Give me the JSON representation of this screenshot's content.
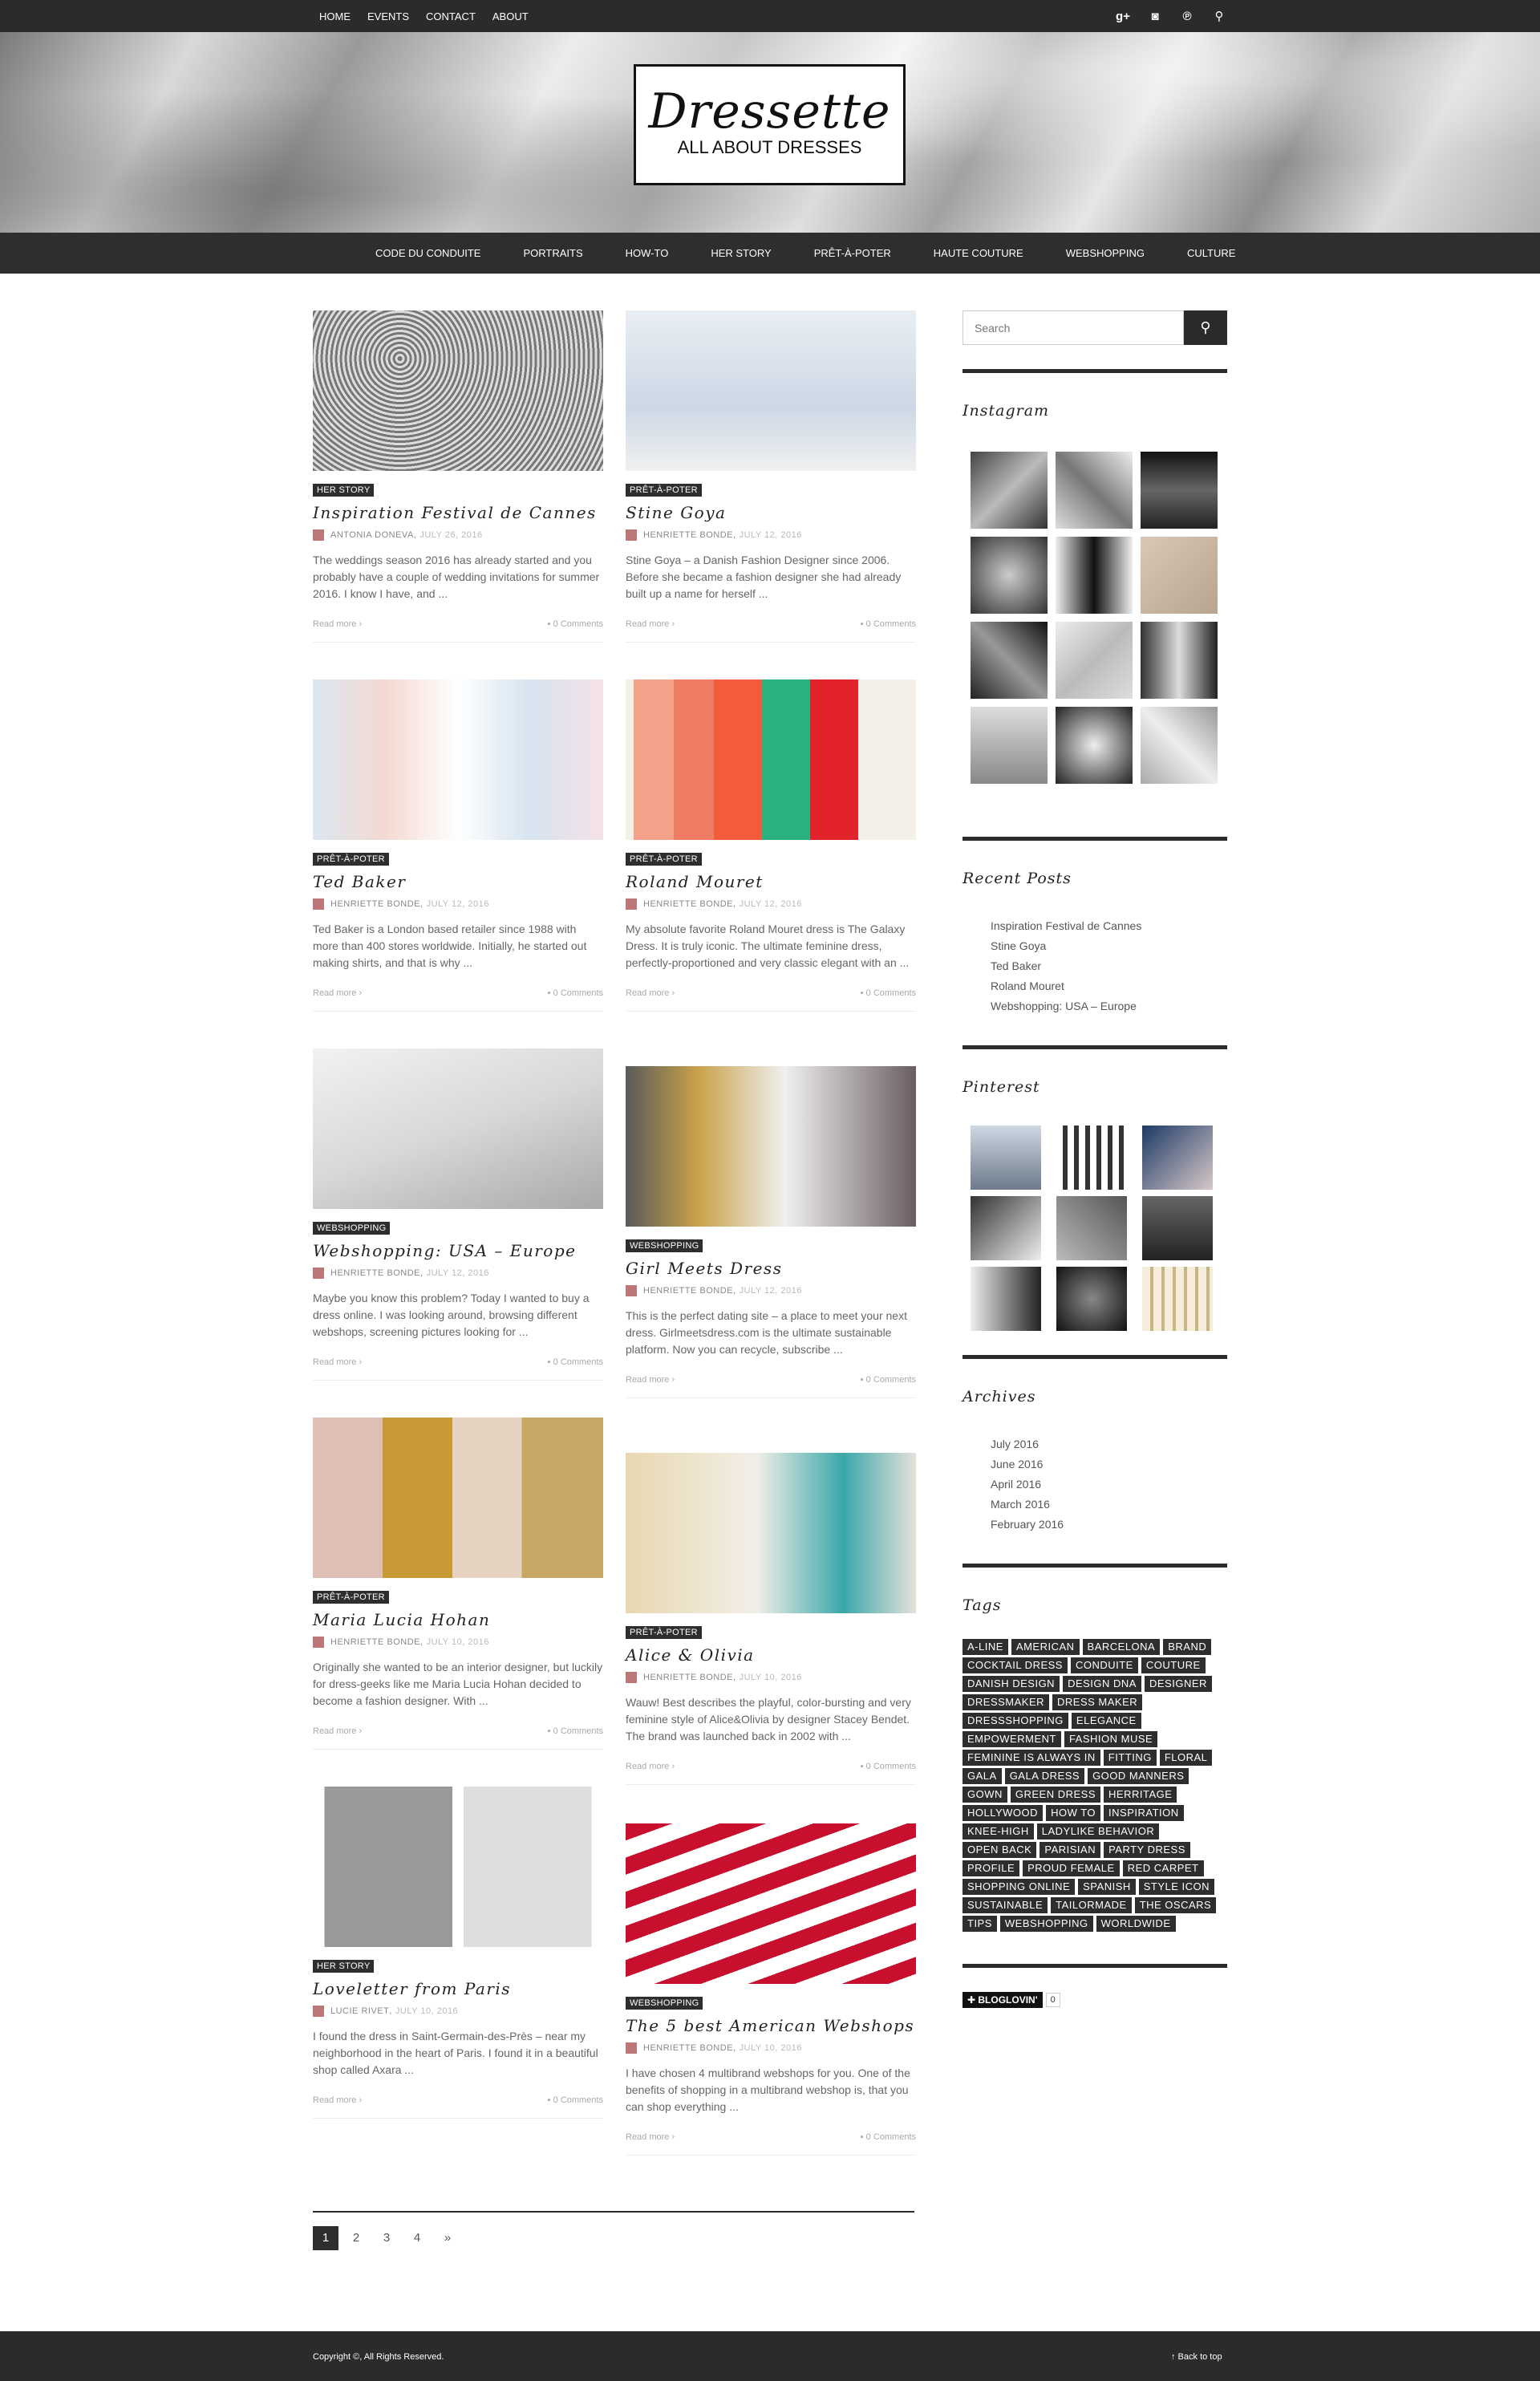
{
  "topbar": {
    "nav": [
      "HOME",
      "EVENTS",
      "CONTACT",
      "ABOUT"
    ],
    "icons": [
      "google-plus-icon",
      "instagram-icon",
      "pinterest-icon",
      "search-icon"
    ]
  },
  "header": {
    "logo_title": "Dressette",
    "logo_subtitle": "ALL ABOUT DRESSES"
  },
  "catnav": [
    "CODE DU CONDUITE",
    "PORTRAITS",
    "HOW-TO",
    "HER STORY",
    "PRÊT-À-POTER",
    "HAUTE COUTURE",
    "WEBSHOPPING",
    "CULTURE"
  ],
  "posts": [
    {
      "cat": "HER STORY",
      "title": "Inspiration Festival de Cannes",
      "author": "ANTONIA DONEVA",
      "date": "JULY 26, 2016",
      "excerpt": "The weddings season 2016 has already started and you probably have a couple of wedding invitations for summer 2016. I know I have, and ...",
      "read": "Read more",
      "comments": "0 Comments"
    },
    {
      "cat": "PRÊT-À-POTER",
      "title": "Stine Goya",
      "author": "HENRIETTE BONDE",
      "date": "JULY 12, 2016",
      "excerpt": "Stine Goya – a Danish Fashion Designer since 2006. Before she became a fashion designer she had already built up a name for herself ...",
      "read": "Read more",
      "comments": "0 Comments"
    },
    {
      "cat": "PRÊT-À-POTER",
      "title": "Ted Baker",
      "author": "HENRIETTE BONDE",
      "date": "JULY 12, 2016",
      "excerpt": "Ted Baker is a London based retailer since 1988 with more than 400 stores worldwide. Initially, he started out making shirts, and that is why ...",
      "read": "Read more",
      "comments": "0 Comments"
    },
    {
      "cat": "PRÊT-À-POTER",
      "title": "Roland Mouret",
      "author": "HENRIETTE BONDE",
      "date": "JULY 12, 2016",
      "excerpt": "My absolute favorite Roland Mouret dress is The Galaxy Dress. It is truly iconic. The ultimate feminine dress, perfectly-proportioned and very classic elegant with an ...",
      "read": "Read more",
      "comments": "0 Comments"
    },
    {
      "cat": "WEBSHOPPING",
      "title": "Webshopping: USA – Europe",
      "author": "HENRIETTE BONDE",
      "date": "JULY 12, 2016",
      "excerpt": "Maybe you know this problem? Today I wanted to buy a dress online. I was looking around, browsing different webshops, screening pictures looking for ...",
      "read": "Read more",
      "comments": "0 Comments"
    },
    {
      "cat": "WEBSHOPPING",
      "title": "Girl Meets Dress",
      "author": "HENRIETTE BONDE",
      "date": "JULY 12, 2016",
      "excerpt": "This is the perfect dating site – a place to meet your next dress. Girlmeetsdress.com is the ultimate sustainable platform. Now you can recycle, subscribe ...",
      "read": "Read more",
      "comments": "0 Comments"
    },
    {
      "cat": "PRÊT-À-POTER",
      "title": "Maria Lucia Hohan",
      "author": "HENRIETTE BONDE",
      "date": "JULY 10, 2016",
      "excerpt": "Originally she wanted to be an interior designer, but luckily for dress-geeks like me Maria Lucia Hohan decided to become a fashion designer. With ...",
      "read": "Read more",
      "comments": "0 Comments"
    },
    {
      "cat": "PRÊT-À-POTER",
      "title": "Alice & Olivia",
      "author": "HENRIETTE BONDE",
      "date": "JULY 10, 2016",
      "excerpt": "Wauw! Best describes the playful, color-bursting and very feminine style of Alice&Olivia by designer Stacey Bendet. The brand was launched back in 2002 with ...",
      "read": "Read more",
      "comments": "0 Comments"
    },
    {
      "cat": "HER STORY",
      "title": "Loveletter from Paris",
      "author": "LUCIE RIVET",
      "date": "JULY 10, 2016",
      "excerpt": "I found the dress in Saint-Germain-des-Près – near my neighborhood in the heart of Paris. I found it in a beautiful shop called Axara ...",
      "read": "Read more",
      "comments": "0 Comments"
    },
    {
      "cat": "WEBSHOPPING",
      "title": "The 5 best American Webshops",
      "author": "HENRIETTE BONDE",
      "date": "JULY 10, 2016",
      "excerpt": "I have chosen 4 multibrand webshops for you. One of the benefits of shopping in a multibrand webshop is, that you can shop everything ...",
      "read": "Read more",
      "comments": "0 Comments"
    }
  ],
  "sidebar": {
    "search_placeholder": "Search",
    "instagram_title": "Instagram",
    "recent_title": "Recent Posts",
    "recent": [
      "Inspiration Festival de Cannes",
      "Stine Goya",
      "Ted Baker",
      "Roland Mouret",
      "Webshopping: USA – Europe"
    ],
    "pinterest_title": "Pinterest",
    "archives_title": "Archives",
    "archives": [
      "July 2016",
      "June 2016",
      "April 2016",
      "March 2016",
      "February 2016"
    ],
    "tags_title": "Tags",
    "tags": [
      "A-LINE",
      "AMERICAN",
      "BARCELONA",
      "BRAND",
      "COCKTAIL DRESS",
      "CONDUITE",
      "COUTURE",
      "DANISH DESIGN",
      "DESIGN DNA",
      "DESIGNER",
      "DRESSMAKER",
      "DRESS MAKER",
      "DRESSSHOPPING",
      "ELEGANCE",
      "EMPOWERMENT",
      "FASHION MUSE",
      "FEMININE IS ALWAYS IN",
      "FITTING",
      "FLORAL",
      "GALA",
      "GALA DRESS",
      "GOOD MANNERS",
      "GOWN",
      "GREEN DRESS",
      "HERRITAGE",
      "HOLLYWOOD",
      "HOW TO",
      "INSPIRATION",
      "KNEE-HIGH",
      "LADYLIKE BEHAVIOR",
      "OPEN BACK",
      "PARISIAN",
      "PARTY DRESS",
      "PROFILE",
      "PROUD FEMALE",
      "RED CARPET",
      "SHOPPING ONLINE",
      "SPANISH",
      "STYLE ICON",
      "SUSTAINABLE",
      "TAILORMADE",
      "THE OSCARS",
      "TIPS",
      "WEBSHOPPING",
      "WORLDWIDE"
    ],
    "bloglovin": "✚ BLOGLOVIN'",
    "bloglovin_count": "0"
  },
  "pagination": [
    "1",
    "2",
    "3",
    "4",
    "»"
  ],
  "footer": {
    "copyright": "Copyright ©, All Rights Reserved.",
    "back_to_top": "↑ Back to top"
  }
}
